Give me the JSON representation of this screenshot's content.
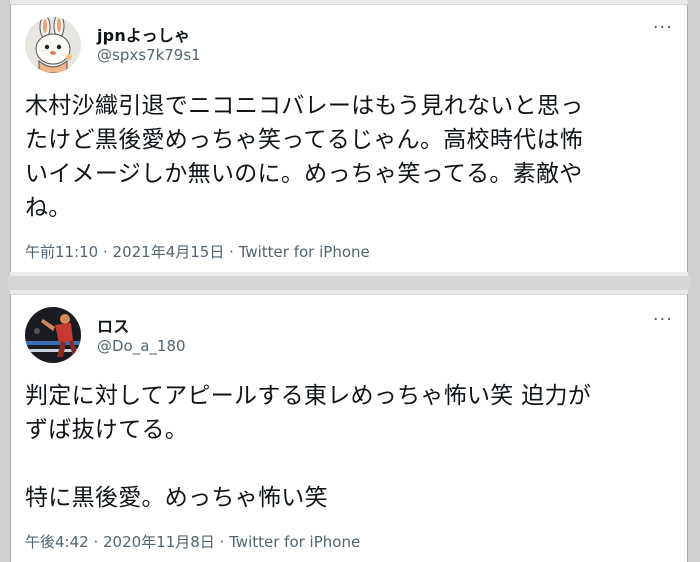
{
  "tweets": [
    {
      "display_name": "jpnよっしゃ",
      "handle": "@spxs7k79s1",
      "more_icon": "···",
      "avatar_icon": "cartoon-rabbit-avatar",
      "text": "木村沙織引退でニコニコバレーはもう見れないと思っ\nたけど黒後愛めっちゃ笑ってるじゃん。高校時代は怖\nいイメージしか無いのに。めっちゃ笑ってる。素敵や\nね。",
      "time": "午前11:10",
      "date": "2021年4月15日",
      "separator": " · ",
      "source": "Twitter for iPhone"
    },
    {
      "display_name": "ロス",
      "handle": "@Do_a_180",
      "more_icon": "···",
      "avatar_icon": "wrestler-photo-avatar",
      "text": "判定に対してアピールする東レめっちゃ怖い笑 迫力が\nずば抜けてる。\n\n特に黒後愛。めっちゃ怖い笑",
      "time": "午後4:42",
      "date": "2020年11月8日",
      "separator": " · ",
      "source": "Twitter for iPhone"
    }
  ]
}
